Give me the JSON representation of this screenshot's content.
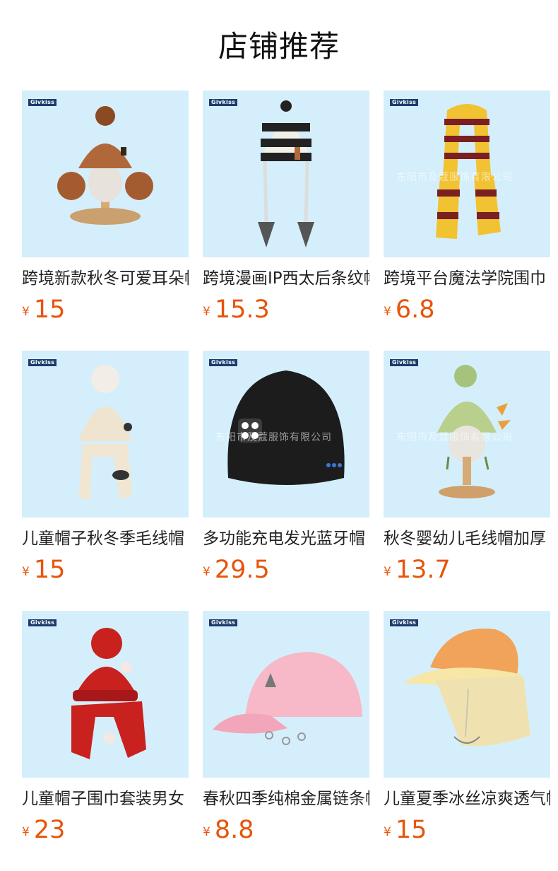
{
  "header": {
    "title": "店铺推荐"
  },
  "products": [
    {
      "name": "跨境新款秋冬可爱耳朵帽",
      "currency": "¥",
      "price": "15",
      "brand": "Givkiss",
      "watermark": "",
      "icon": "brown-knit-hat-icon"
    },
    {
      "name": "跨境漫画IP西太后条纹帽",
      "currency": "¥",
      "price": "15.3",
      "brand": "Givkiss",
      "watermark": "",
      "icon": "striped-beanie-icon"
    },
    {
      "name": "跨境平台魔法学院围巾",
      "currency": "¥",
      "price": "6.8",
      "brand": "Givkiss",
      "watermark": "东阳市及蔻服饰有限公司",
      "icon": "striped-scarf-icon"
    },
    {
      "name": "儿童帽子秋冬季毛线帽",
      "currency": "¥",
      "price": "15",
      "brand": "Givkiss",
      "watermark": "",
      "icon": "cream-hat-scarf-icon"
    },
    {
      "name": "多功能充电发光蓝牙帽",
      "currency": "¥",
      "price": "29.5",
      "brand": "Givkiss",
      "watermark": "东阳市及蔻服饰有限公司",
      "icon": "led-beanie-icon"
    },
    {
      "name": "秋冬婴幼儿毛线帽加厚",
      "currency": "¥",
      "price": "13.7",
      "brand": "Givkiss",
      "watermark": "东阳市及蔻服饰有限公司",
      "icon": "dino-hat-icon"
    },
    {
      "name": "儿童帽子围巾套装男女",
      "currency": "¥",
      "price": "23",
      "brand": "Givkiss",
      "watermark": "",
      "icon": "red-hat-scarf-icon"
    },
    {
      "name": "春秋四季纯棉金属链条帽",
      "currency": "¥",
      "price": "8.8",
      "brand": "Givkiss",
      "watermark": "",
      "icon": "pink-cap-icon"
    },
    {
      "name": "儿童夏季冰丝凉爽透气帽",
      "currency": "¥",
      "price": "15",
      "brand": "Givkiss",
      "watermark": "",
      "icon": "sun-hat-icon"
    }
  ]
}
